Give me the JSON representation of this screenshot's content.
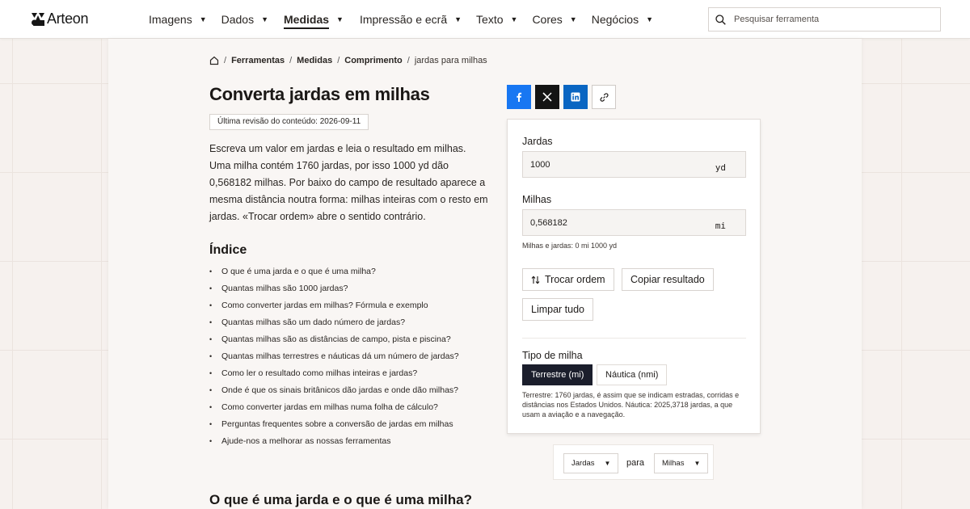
{
  "brand": {
    "name": "Arteon"
  },
  "nav": {
    "items": [
      {
        "label": "Imagens",
        "caret": "▼"
      },
      {
        "label": "Dados",
        "caret": "▼"
      },
      {
        "label": "Medidas",
        "caret": "▼"
      },
      {
        "label": "Impressão e ecrã",
        "caret": "▼"
      },
      {
        "label": "Texto",
        "caret": "▼"
      },
      {
        "label": "Cores",
        "caret": "▼"
      },
      {
        "label": "Negócios",
        "caret": "▼"
      }
    ],
    "active_label": "Medidas"
  },
  "search": {
    "placeholder": "Pesquisar ferramenta"
  },
  "breadcrumb": {
    "items": [
      "Ferramentas",
      "Medidas",
      "Comprimento"
    ],
    "current": "jardas para milhas",
    "separator": "/"
  },
  "page": {
    "title": "Converta jardas em milhas",
    "revision": "Última revisão do conteúdo: 2026-09-11",
    "intro": "Escreva um valor em jardas e leia o resultado em milhas. Uma milha contém 1760 jardas, por isso 1000 yd dão 0,568182 milhas. Por baixo do campo de resultado aparece a mesma distância noutra forma: milhas inteiras com o resto em jardas. «Trocar ordem» abre o sentido contrário.",
    "toc_title": "Índice",
    "toc": [
      "O que é uma jarda e o que é uma milha?",
      "Quantas milhas são 1000 jardas?",
      "Como converter jardas em milhas? Fórmula e exemplo",
      "Quantas milhas são um dado número de jardas?",
      "Quantas milhas são as distâncias de campo, pista e piscina?",
      "Quantas milhas terrestres e náuticas dá um número de jardas?",
      "Como ler o resultado como milhas inteiras e jardas?",
      "Onde é que os sinais britânicos dão jardas e onde dão milhas?",
      "Como converter jardas em milhas numa folha de cálculo?",
      "Perguntas frequentes sobre a conversão de jardas em milhas",
      "Ajude-nos a melhorar as nossas ferramentas"
    ],
    "section_heading": "O que é uma jarda e o que é uma milha?"
  },
  "share": {
    "icons": [
      "facebook-icon",
      "x-icon",
      "linkedin-icon",
      "link-icon"
    ],
    "colors": {
      "facebook": "#1877f2",
      "x": "#141414",
      "linkedin": "#0a66c2"
    }
  },
  "converter": {
    "input_label": "Jardas",
    "input_value": "1000",
    "input_unit": "yd",
    "output_label": "Milhas",
    "output_value": "0,568182",
    "output_unit": "mi",
    "output_hint": "Milhas e jardas: 0 mi 1000 yd",
    "swap_label": "Trocar ordem",
    "copy_label": "Copiar resultado",
    "clear_label": "Limpar tudo",
    "mile_type_label": "Tipo de milha",
    "mile_type_options": [
      "Terrestre (mi)",
      "Náutica (nmi)"
    ],
    "mile_type_selected": "Terrestre (mi)",
    "mile_type_note": "Terrestre: 1760 jardas, é assim que se indicam estradas, corridas e distâncias nos Estados Unidos. Náutica: 2025,3718 jardas, a que usam a aviação e a navegação.",
    "accent_color": "#1b1e2c"
  },
  "unit_picker": {
    "from": "Jardas",
    "connector": "para",
    "to": "Milhas",
    "caret": "▼"
  }
}
